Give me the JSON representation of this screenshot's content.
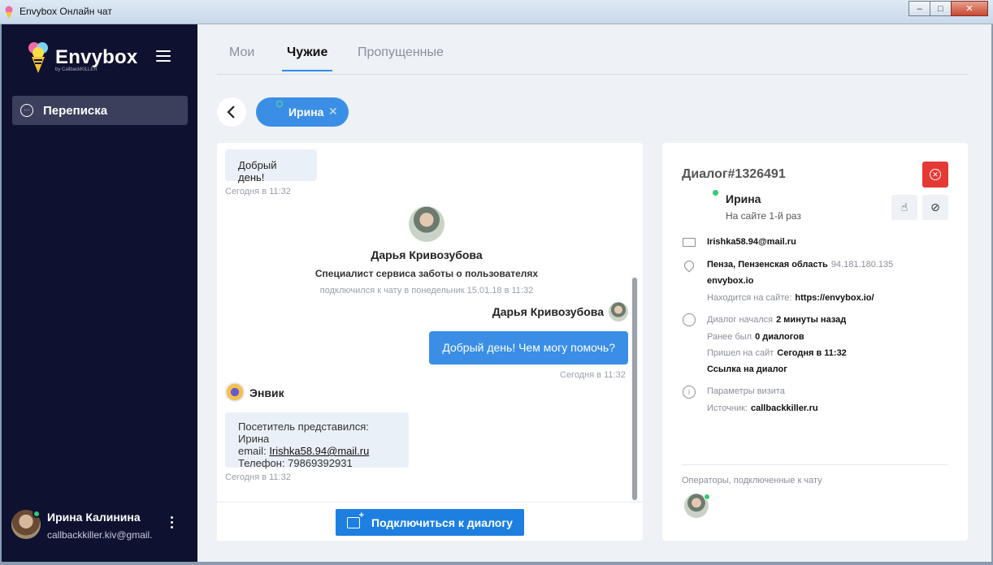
{
  "window": {
    "title": "Envybox Онлайн чат",
    "minimize": "–",
    "maximize": "□",
    "close": "✕"
  },
  "brand": {
    "name": "Envybox",
    "sub": "by CallbackKILLER"
  },
  "sidebar": {
    "nav": [
      {
        "label": "Переписка",
        "icon": "chat-icon"
      }
    ],
    "user": {
      "name": "Ирина Калинина",
      "email": "callbackkiller.kiv@gmail."
    }
  },
  "tabs": [
    {
      "label": "Мои",
      "active": false
    },
    {
      "label": "Чужие",
      "active": true
    },
    {
      "label": "Пропущенные",
      "active": false
    }
  ],
  "chip": {
    "name": "Ирина",
    "close": "✕"
  },
  "chat": {
    "first_message": "Добрый день!",
    "first_time": "Сегодня в 11:32",
    "operator": {
      "name": "Дарья Кривозубова",
      "role": "Специалист сервиса заботы о пользователях",
      "joined": "подключился к чату в понедельник 15.01.18 в 11:32"
    },
    "reply_sender": "Дарья Кривозубова",
    "reply_message": "Добрый день! Чем могу помочь?",
    "reply_time": "Сегодня в 11:32",
    "bot_name": "Энвик",
    "bot_line1": "Посетитель представился: Ирина",
    "bot_email_label": "email:",
    "bot_email": "Irishka58.94@mail.ru",
    "bot_phone": "Телефон: 79869392931",
    "bot_time": "Сегодня в 11:32",
    "connect_label": "Подключиться к диалогу"
  },
  "dialog": {
    "title": "Диалог#1326491",
    "visitor_name": "Ирина",
    "visits": "На сайте 1-й раз",
    "email": "Irishka58.94@mail.ru",
    "location": "Пенза, Пензенская область",
    "ip": "94.181.180.135",
    "site": "envybox.io",
    "on_site_label": "Находится на сайте:",
    "on_site_url": "https://envybox.io/",
    "started_label": "Диалог начался",
    "started_value": "2 минуты назад",
    "before_label": "Ранее был",
    "before_value": "0 диалогов",
    "came_label": "Пришел на сайт",
    "came_value": "Сегодня в 11:32",
    "link_label": "Ссылка на диалог",
    "params_label": "Параметры визита",
    "source_label": "Источник:",
    "source_value": "callbackkiller.ru",
    "operators_label": "Операторы, подключенные к чату"
  },
  "colors": {
    "sidebar": "#0e1230",
    "accent": "#3a8ee6",
    "danger": "#e53935",
    "online": "#2ecc71"
  }
}
